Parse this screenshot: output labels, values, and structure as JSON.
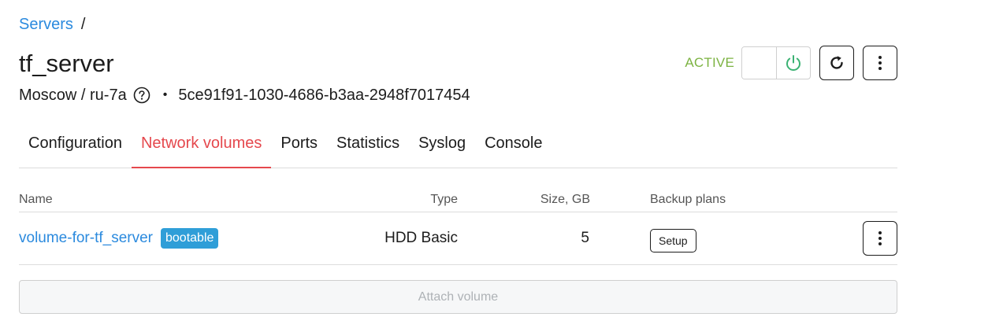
{
  "breadcrumb": {
    "root": "Servers",
    "separator": "/"
  },
  "server": {
    "name": "tf_server",
    "region": "Moscow / ru-7a",
    "separator_dot": "•",
    "id": "5ce91f91-1030-4686-b3aa-2948f7017454",
    "status": "ACTIVE"
  },
  "tabs": [
    {
      "label": "Configuration"
    },
    {
      "label": "Network volumes",
      "active": true
    },
    {
      "label": "Ports"
    },
    {
      "label": "Statistics"
    },
    {
      "label": "Syslog"
    },
    {
      "label": "Console"
    }
  ],
  "volumes_table": {
    "columns": {
      "name": "Name",
      "type": "Type",
      "size": "Size, GB",
      "backup": "Backup plans"
    },
    "rows": [
      {
        "name": "volume-for-tf_server",
        "badge": "bootable",
        "type": "HDD Basic",
        "size": "5",
        "backup_action": "Setup"
      }
    ]
  },
  "attach_label": "Attach volume",
  "icons": {
    "help": "question-circle-icon",
    "power": "power-icon",
    "reload": "reload-icon",
    "more": "more-vertical-icon"
  },
  "colors": {
    "link": "#2b8ade",
    "active_tab": "#e5484d",
    "status_active": "#7cb342",
    "power_icon": "#3bb273",
    "badge_bg": "#2f9ed8"
  }
}
